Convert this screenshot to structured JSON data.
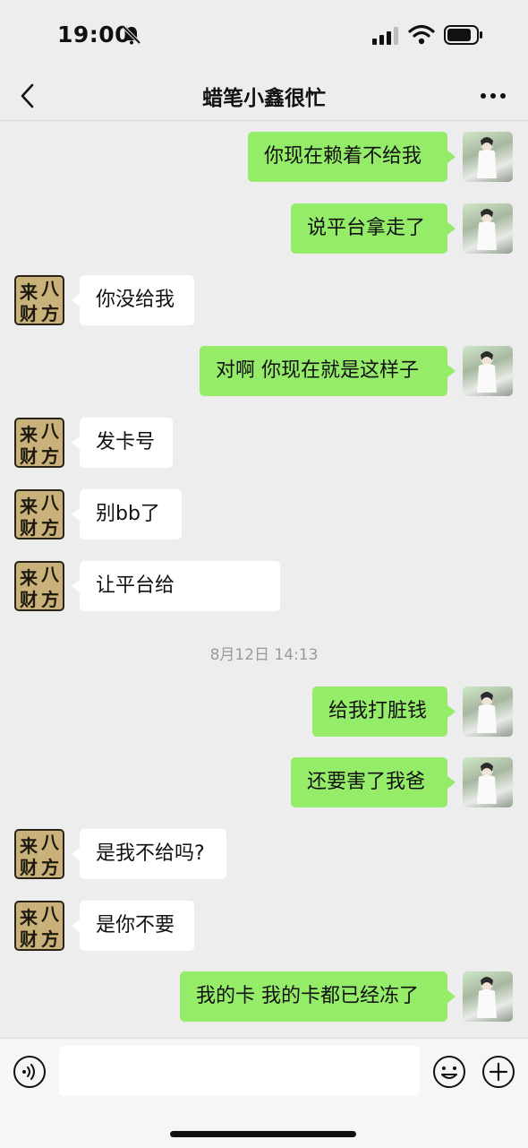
{
  "status_bar": {
    "time": "19:00"
  },
  "header": {
    "title": "蜡笔小鑫很忙"
  },
  "messages": [
    {
      "side": "right",
      "text": "你现在赖着不给我"
    },
    {
      "side": "right",
      "text": "说平台拿走了"
    },
    {
      "side": "left",
      "text": "你没给我"
    },
    {
      "side": "right",
      "text": "对啊 你现在就是这样子"
    },
    {
      "side": "left",
      "text": "发卡号"
    },
    {
      "side": "left",
      "text": "别bb了"
    },
    {
      "side": "left",
      "text": "让平台给"
    },
    {
      "side": "right",
      "text": "给我打脏钱"
    },
    {
      "side": "right",
      "text": "还要害了我爸"
    },
    {
      "side": "left",
      "text": "是我不给吗?"
    },
    {
      "side": "left",
      "text": "是你不要"
    },
    {
      "side": "right",
      "text": "我的卡 我的卡都已经冻了"
    }
  ],
  "timestamp": "8月12日 14:13",
  "contact_avatar_text": [
    "来",
    "八",
    "财",
    "方"
  ],
  "input": {
    "value": "",
    "placeholder": ""
  },
  "colors": {
    "right_bubble": "#95ec69",
    "left_bubble": "#ffffff",
    "background": "#ededed"
  },
  "icons": [
    "mute-icon",
    "signal-icon",
    "wifi-icon",
    "battery-icon",
    "back-icon",
    "more-icon",
    "voice-icon",
    "emoji-icon",
    "plus-icon"
  ]
}
